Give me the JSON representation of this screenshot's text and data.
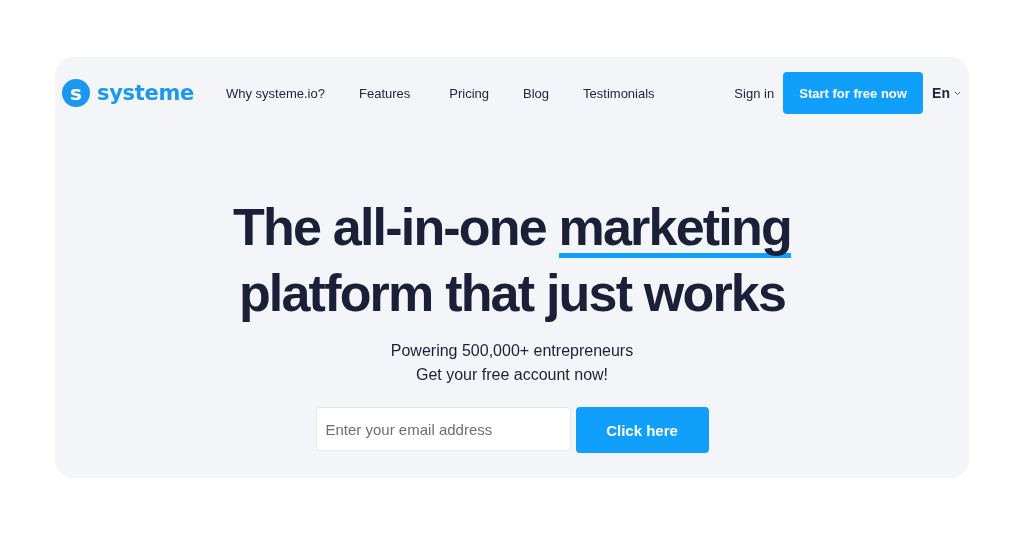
{
  "brand": {
    "mark": "s",
    "name": "systeme"
  },
  "nav": {
    "links": [
      "Why systeme.io?",
      "Features",
      "Pricing",
      "Blog",
      "Testimonials"
    ],
    "sign_in": "Sign in",
    "cta": "Start for free now",
    "language": "En"
  },
  "hero": {
    "headline": [
      {
        "text": "The all-in-one ",
        "highlighted": false
      },
      {
        "text": "marketing",
        "highlighted": true
      }
    ],
    "headline_line2": "platform that just works",
    "subtitle": [
      "Powering 500,000+ entrepreneurs",
      "Get your free account now!"
    ],
    "email": {
      "placeholder": "Enter your email address"
    },
    "submit": "Click here"
  }
}
